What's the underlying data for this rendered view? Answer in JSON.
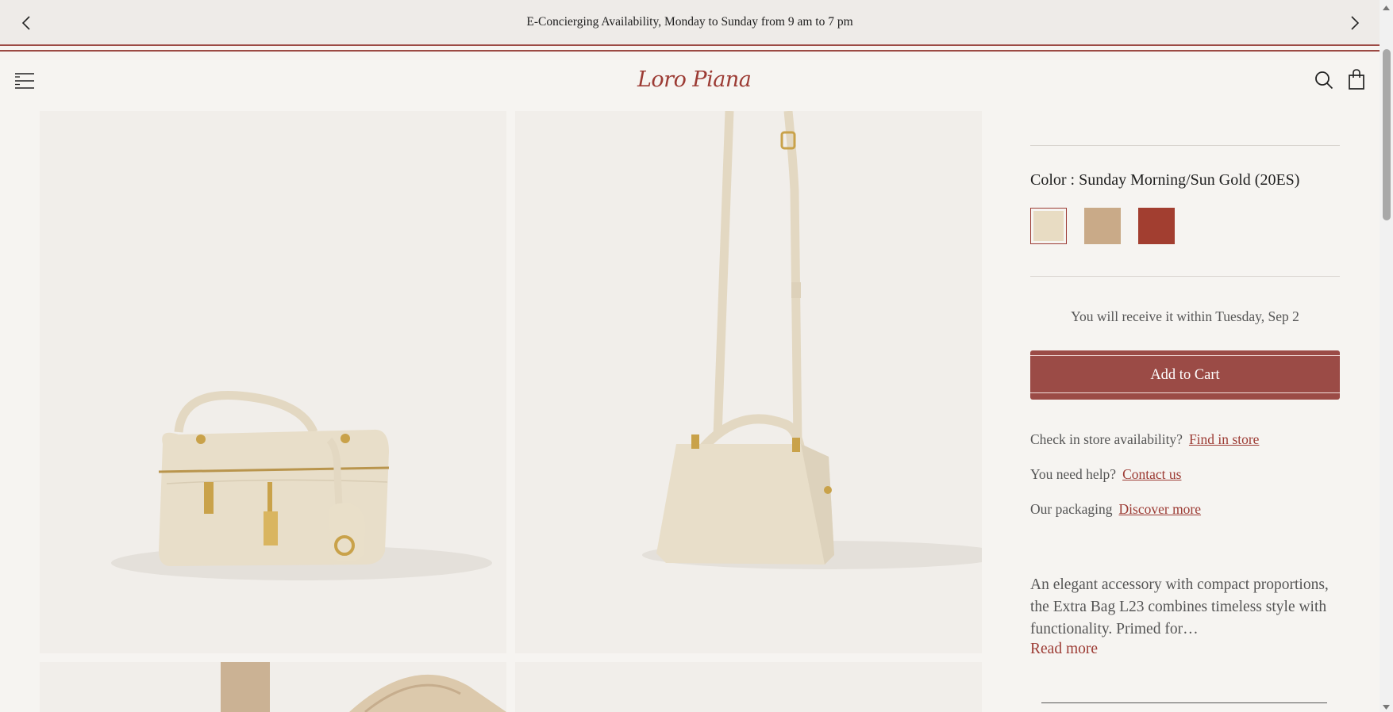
{
  "announcement": {
    "text": "E-Concierging Availability, Monday to Sunday from 9 am to 7 pm"
  },
  "header": {
    "logo_text": "Loro Piana"
  },
  "product": {
    "color_label": "Color : Sunday Morning/Sun Gold (20ES)",
    "swatches": [
      {
        "name": "Sunday Morning/Sun Gold",
        "color": "#e8dcc3",
        "selected": true
      },
      {
        "name": "beige",
        "color": "#c9aa88",
        "selected": false
      },
      {
        "name": "red",
        "color": "#a23e30",
        "selected": false
      }
    ],
    "delivery_text": "You will receive it within Tuesday, Sep 2",
    "add_to_cart_label": "Add to Cart",
    "store_question": "Check in store availability?",
    "store_link": "Find in store",
    "help_question": "You need help?",
    "help_link": "Contact us",
    "packaging_label": "Our packaging",
    "packaging_link": "Discover more",
    "description": "An elegant accessory with compact proportions, the Extra Bag L23 combines timeless style with functionality. Primed for…",
    "read_more_label": "Read more"
  },
  "colors": {
    "accent": "#9b4b46",
    "brand": "#9c3b34",
    "background": "#f6f4f1",
    "tile": "#f1eeea",
    "bag": "#e6dcc6"
  }
}
